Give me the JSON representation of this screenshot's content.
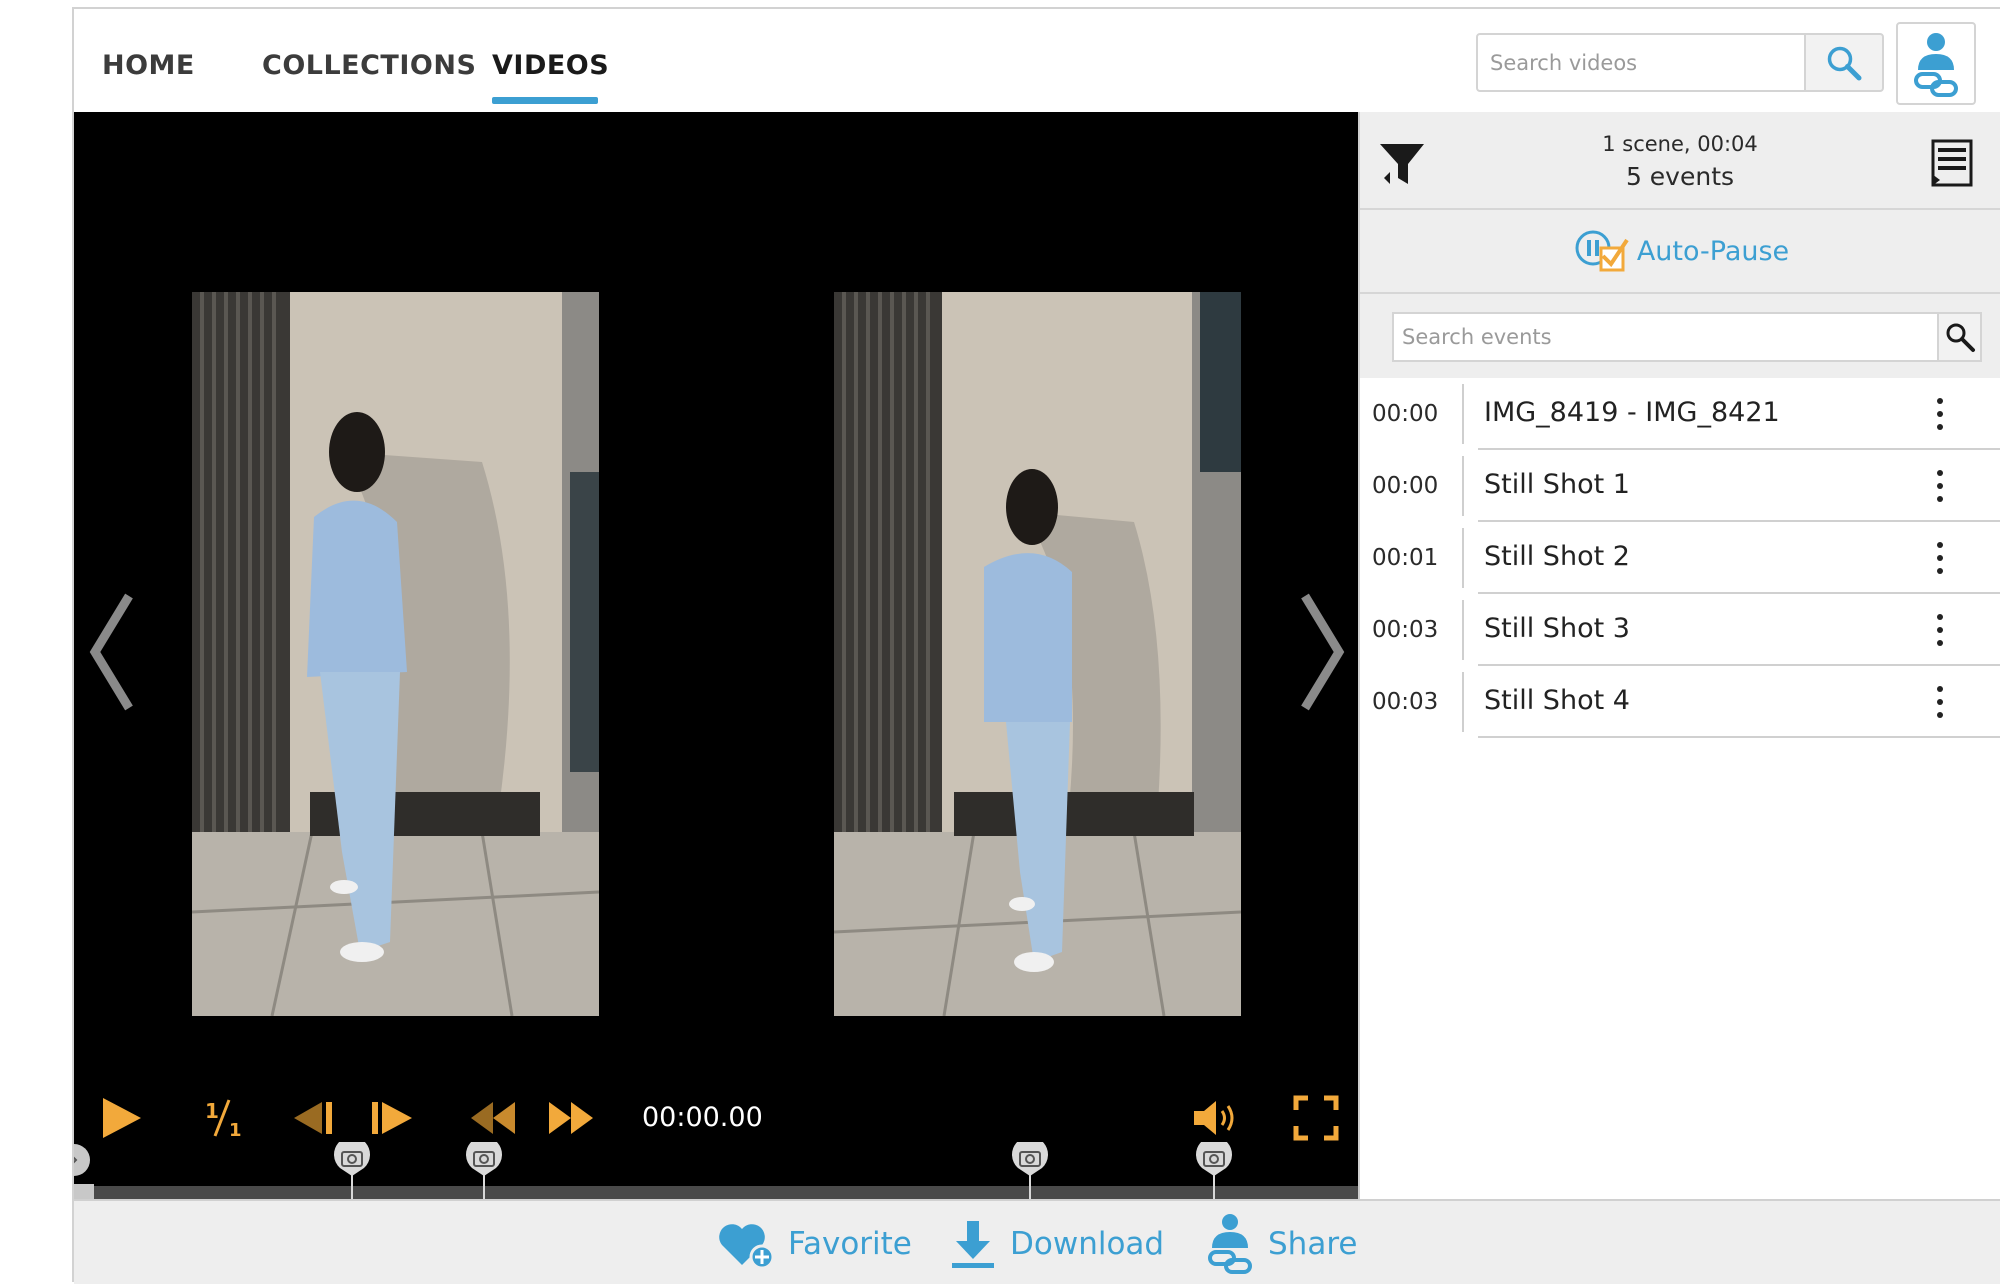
{
  "nav": {
    "tabs": [
      {
        "label": "HOME"
      },
      {
        "label": "COLLECTIONS"
      },
      {
        "label": "VIDEOS"
      }
    ],
    "active_tab": "VIDEOS",
    "search_placeholder": "Search videos",
    "accent_color": "#3c9fd2"
  },
  "player": {
    "timecode": "00:00.00",
    "speed_label": "1/1",
    "controls_color": "#f2a93b",
    "markers_count": 4
  },
  "side": {
    "scene_summary": "1 scene, 00:04",
    "event_count": "5 events",
    "autopause_label": "Auto-Pause",
    "event_search_placeholder": "Search events",
    "events": [
      {
        "time": "00:00",
        "title": "IMG_8419 - IMG_8421"
      },
      {
        "time": "00:00",
        "title": "Still Shot 1"
      },
      {
        "time": "00:01",
        "title": "Still Shot 2"
      },
      {
        "time": "00:03",
        "title": "Still Shot 3"
      },
      {
        "time": "00:03",
        "title": "Still Shot 4"
      }
    ]
  },
  "actions": {
    "favorite_label": "Favorite",
    "download_label": "Download",
    "share_label": "Share"
  }
}
